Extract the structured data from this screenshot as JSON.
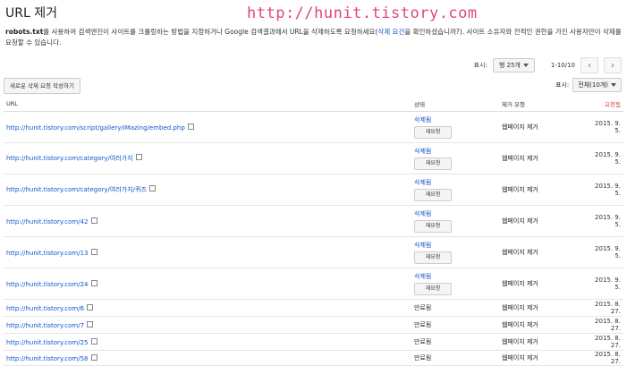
{
  "page": {
    "title": "URL 제거",
    "watermark": "http://hunit.tistory.com"
  },
  "description": {
    "bold_prefix": "robots.txt",
    "text_before_link": "를 사용하여 검색엔진이 사이트를 크롤링하는 방법을 지정하거나 Google 검색결과에서 URL을 삭제하도록 요청하세요(",
    "link_text": "삭제 요건",
    "text_after_link": "을 확인하셨습니까?). 사이트 소유자와 전적인 권한을 가진 사용자만이 삭제를 요청할 수 있습니다."
  },
  "pagination": {
    "show_label": "표시:",
    "per_page_value": "행 25개",
    "range": "1-10/10",
    "prev_icon": "chevron-left-icon",
    "next_icon": "chevron-right-icon"
  },
  "toolbar": {
    "new_request_label": "새로운 삭제 요청 작성하기",
    "filter_label": "표시:",
    "filter_value": "전체(10개)"
  },
  "table": {
    "columns": {
      "url": "URL",
      "status": "상태",
      "type": "제거 유형",
      "date": "요청됨"
    },
    "resubmit_label": "재요청",
    "rows": [
      {
        "url": "http://hunit.tistory.com/script/gallery/iMazing/embed.php",
        "status": "삭제됨",
        "type": "웹페이지 제거",
        "date": "2015. 9. 5."
      },
      {
        "url": "http://hunit.tistory.com/category/여러가지",
        "status": "삭제됨",
        "type": "웹페이지 제거",
        "date": "2015. 9. 5."
      },
      {
        "url": "http://hunit.tistory.com/category/여러가지/퀴즈",
        "status": "삭제됨",
        "type": "웹페이지 제거",
        "date": "2015. 9. 5."
      },
      {
        "url": "http://hunit.tistory.com/42",
        "status": "삭제됨",
        "type": "웹페이지 제거",
        "date": "2015. 9. 5."
      },
      {
        "url": "http://hunit.tistory.com/13",
        "status": "삭제됨",
        "type": "웹페이지 제거",
        "date": "2015. 9. 5."
      },
      {
        "url": "http://hunit.tistory.com/24",
        "status": "삭제됨",
        "type": "웹페이지 제거",
        "date": "2015. 9. 5."
      },
      {
        "url": "http://hunit.tistory.com/6",
        "status": "만료됨",
        "type": "웹페이지 제거",
        "date": "2015. 8. 27."
      },
      {
        "url": "http://hunit.tistory.com/7",
        "status": "만료됨",
        "type": "웹페이지 제거",
        "date": "2015. 8. 27."
      },
      {
        "url": "http://hunit.tistory.com/25",
        "status": "만료됨",
        "type": "웹페이지 제거",
        "date": "2015. 8. 27."
      },
      {
        "url": "http://hunit.tistory.com/58",
        "status": "만료됨",
        "type": "웹페이지 제거",
        "date": "2015. 8. 27."
      }
    ]
  },
  "colors": {
    "link": "#1155cc",
    "sort_header": "#dd4b39",
    "watermark": "#e0467a"
  }
}
